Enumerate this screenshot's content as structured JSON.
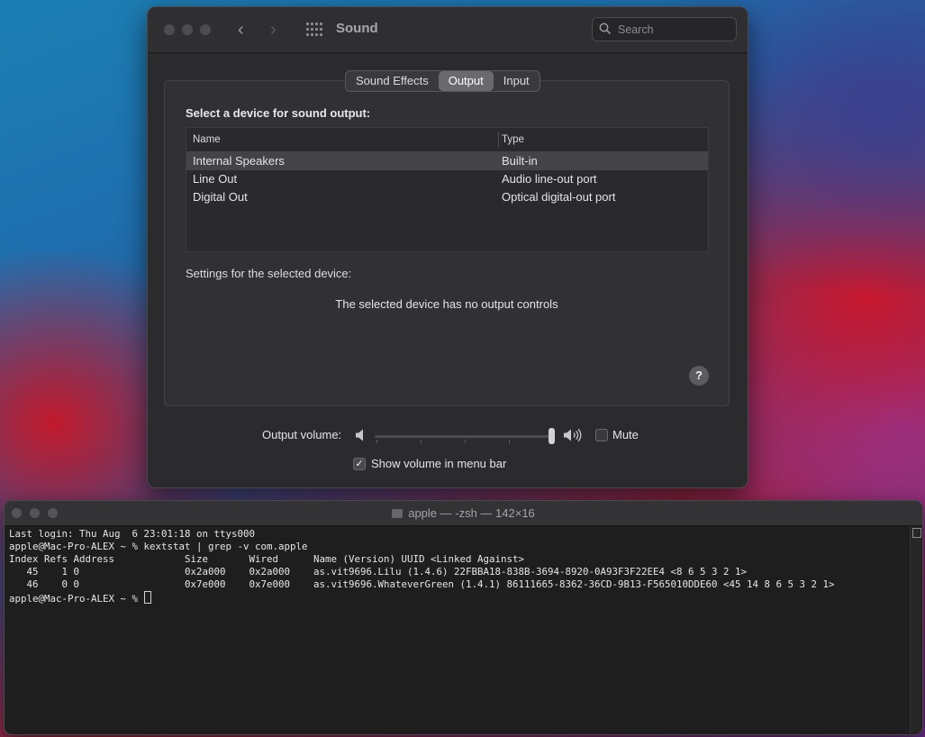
{
  "sound_window": {
    "title": "Sound",
    "search_placeholder": "Search",
    "tabs": [
      {
        "label": "Sound Effects",
        "active": false
      },
      {
        "label": "Output",
        "active": true
      },
      {
        "label": "Input",
        "active": false
      }
    ],
    "select_label": "Select a device for sound output:",
    "table": {
      "columns": [
        "Name",
        "Type"
      ],
      "rows": [
        {
          "name": "Internal Speakers",
          "type": "Built-in",
          "selected": true
        },
        {
          "name": "Line Out",
          "type": "Audio line-out port",
          "selected": false
        },
        {
          "name": "Digital Out",
          "type": "Optical digital-out port",
          "selected": false
        }
      ]
    },
    "settings_label": "Settings for the selected device:",
    "no_controls_text": "The selected device has no output controls",
    "help_label": "?",
    "output_volume_label": "Output volume:",
    "output_volume_level": 1.0,
    "mute_label": "Mute",
    "mute_checked": false,
    "show_volume_label": "Show volume in menu bar",
    "show_volume_checked": true
  },
  "terminal": {
    "title": "apple — -zsh — 142×16",
    "lines": [
      "Last login: Thu Aug  6 23:01:18 on ttys000",
      "apple@Mac-Pro-ALEX ~ % kextstat | grep -v com.apple",
      "Index Refs Address            Size       Wired      Name (Version) UUID <Linked Against>",
      "   45    1 0                  0x2a000    0x2a000    as.vit9696.Lilu (1.4.6) 22FBBA18-838B-3694-8920-0A93F3F22EE4 <8 6 5 3 2 1>",
      "   46    0 0                  0x7e000    0x7e000    as.vit9696.WhateverGreen (1.4.1) 86111665-8362-36CD-9B13-F565010DDE60 <45 14 8 6 5 3 2 1>"
    ],
    "prompt": "apple@Mac-Pro-ALEX ~ % "
  },
  "colors": {
    "window_bg": "#2b2b2d",
    "selected_row": "#444446",
    "active_tab": "#6a6a6e",
    "terminal_bg": "#1e1e1e"
  }
}
